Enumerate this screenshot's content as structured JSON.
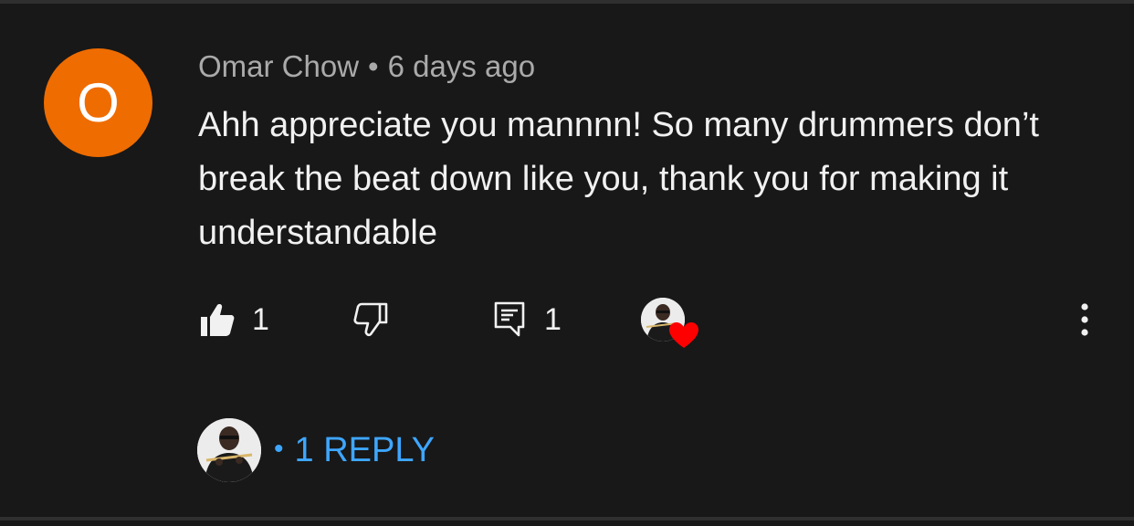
{
  "comment": {
    "author_initial": "O",
    "author": "Omar Chow",
    "separator": "•",
    "time": "6 days ago",
    "text": "Ahh appreciate you mannnn! So many drummers don’t break the beat down like you, thank you for making it understandable",
    "likes": "1",
    "replies_count": "1",
    "hearted_by_creator": true
  },
  "replies": {
    "separator": "•",
    "label": "1 REPLY"
  },
  "colors": {
    "background": "#181818",
    "avatar": "#ef6c00",
    "link": "#3ea6ff",
    "heart": "#ff0000"
  },
  "icons": [
    "thumbs-up-icon",
    "thumbs-down-icon",
    "reply-icon",
    "heart-icon",
    "more-vertical-icon"
  ]
}
